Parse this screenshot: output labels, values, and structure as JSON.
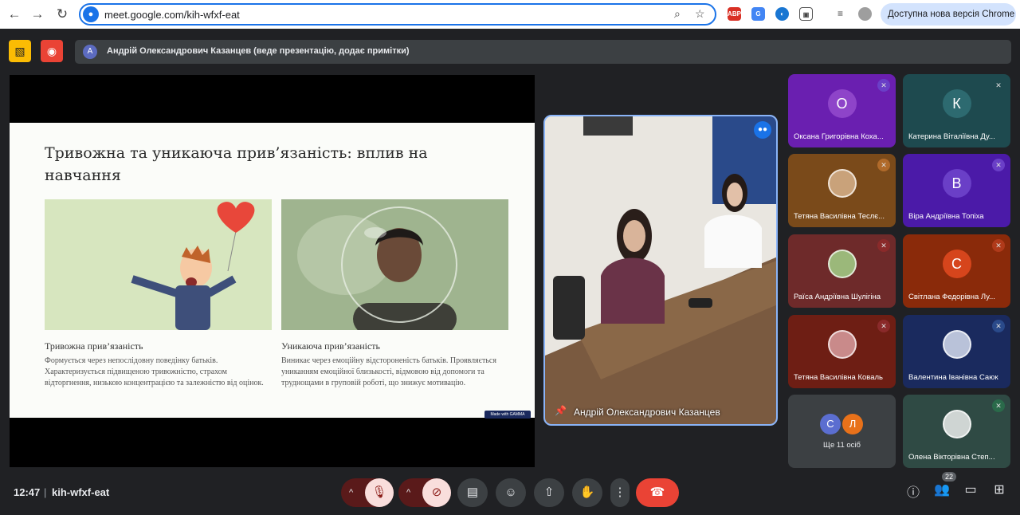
{
  "browser": {
    "url": "meet.google.com/kih-wfxf-eat",
    "update_label": "Доступна нова версія Chrome"
  },
  "presenter_bar": {
    "initial": "А",
    "text": "Андрій Олександрович Казанцев (веде презентацію, додає примітки)"
  },
  "slide": {
    "title": "Тривожна та уникаюча прив’язаність: вплив на навчання",
    "left_heading": "Тривожна прив’язаність",
    "left_text": "Формується через непослідовну поведінку батьків. Характеризується підвищеною тривожністю, страхом відторгнення, низькою концентрацією та залежністю від оцінок.",
    "right_heading": "Уникаюча прив’язаність",
    "right_text": "Виникає через емоційну відстороненість батьків. Проявляється униканням емоційної близькості, відмовою від допомоги та труднощами в груповій роботі, що знижує мотивацію.",
    "badge": "Made with GAMMA"
  },
  "main_video": {
    "name": "Андрій Олександрович Казанцев"
  },
  "participants": [
    {
      "initial": "О",
      "name": "Оксана Григорівна Коха...",
      "bg": "#6a1fb0",
      "avatar": "#8e44c9"
    },
    {
      "initial": "К",
      "name": "Катерина Віталіївна Ду...",
      "bg": "#1e4a4f",
      "avatar": "#2d6a70"
    },
    {
      "initial": "",
      "name": "Тетяна Василівна Теслє...",
      "bg": "#7a4a1a",
      "avatar": "#c9a27a"
    },
    {
      "initial": "В",
      "name": "Віра Андріївна Топіха",
      "bg": "#4b1aa8",
      "avatar": "#6a3fc7"
    },
    {
      "initial": "",
      "name": "Раїса Андріївна Шулігіна",
      "bg": "#6e2a2a",
      "avatar": "#9bb87a"
    },
    {
      "initial": "С",
      "name": "Світлана Федорівна Лу...",
      "bg": "#8a2a0a",
      "avatar": "#d6451c"
    },
    {
      "initial": "",
      "name": "Тетяна Василівна Коваль",
      "bg": "#6e1e14",
      "avatar": "#c98a8a"
    },
    {
      "initial": "",
      "name": "Валентина Іванівна Саюк",
      "bg": "#1a2a5e",
      "avatar": "#b9c2d9"
    },
    {
      "initial": "",
      "name": "Олена Вікторівна Степ...",
      "bg": "#2f4a44",
      "avatar": "#cfd5d3"
    }
  ],
  "more": {
    "label": "Ще 11 осіб",
    "a": "С",
    "b": "Л"
  },
  "bottom": {
    "time": "12:47",
    "code": "kih-wfxf-eat",
    "people_count": "22"
  }
}
